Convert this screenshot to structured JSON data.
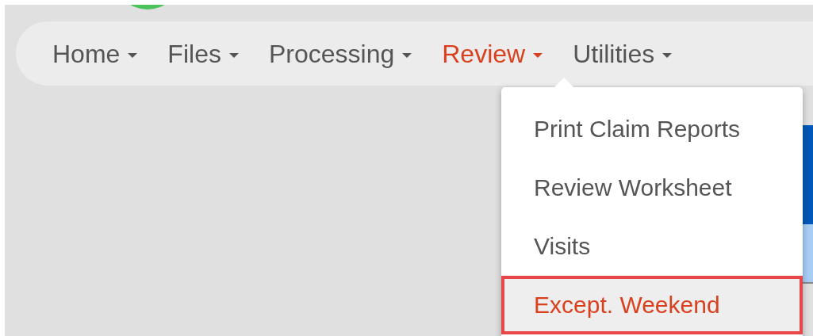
{
  "navbar": {
    "items": [
      {
        "label": "Home",
        "selected": false
      },
      {
        "label": "Files",
        "selected": false
      },
      {
        "label": "Processing",
        "selected": false
      },
      {
        "label": "Review",
        "selected": true
      },
      {
        "label": "Utilities",
        "selected": false
      }
    ]
  },
  "dropdown": {
    "items": [
      {
        "label": "Print Claim Reports",
        "highlighted": false
      },
      {
        "label": "Review Worksheet",
        "highlighted": false
      },
      {
        "label": "Visits",
        "highlighted": false
      },
      {
        "label": "Except. Weekend",
        "highlighted": true
      }
    ]
  }
}
